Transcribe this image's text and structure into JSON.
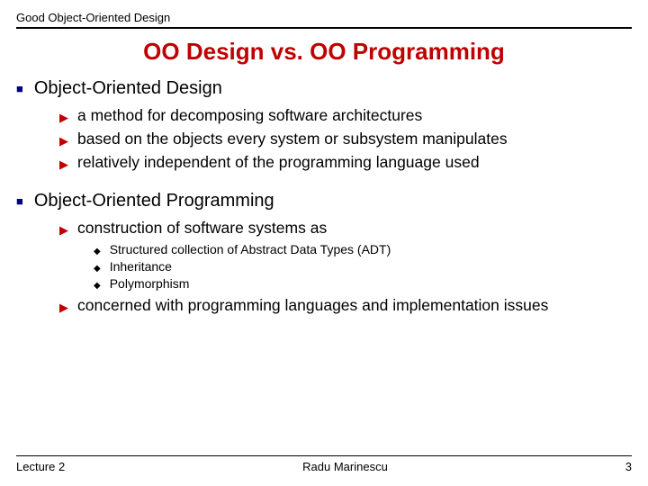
{
  "header": {
    "course": "Good Object-Oriented Design"
  },
  "title": "OO Design vs. OO Programming",
  "sections": [
    {
      "heading": "Object-Oriented Design",
      "items": [
        {
          "text": "a method for decomposing software architectures"
        },
        {
          "text": "based on the objects every system or subsystem manipulates"
        },
        {
          "text": "relatively independent of the programming language used"
        }
      ]
    },
    {
      "heading": "Object-Oriented Programming",
      "items": [
        {
          "text": "construction of software systems as",
          "children": [
            "Structured collection of Abstract Data Types (ADT)",
            "Inheritance",
            "Polymorphism"
          ]
        },
        {
          "text": "concerned with programming languages and implementation issues"
        }
      ]
    }
  ],
  "footer": {
    "left": "Lecture 2",
    "center": "Radu Marinescu",
    "right": "3"
  }
}
